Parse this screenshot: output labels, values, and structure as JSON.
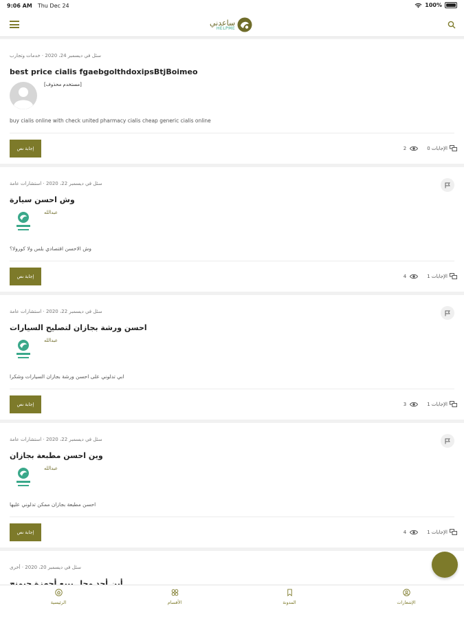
{
  "status_bar": {
    "time": "9:06 AM",
    "day": "Thu Dec 24",
    "battery": "100%"
  },
  "header": {
    "logo_ar": "ساعدني",
    "logo_en": "HELPME"
  },
  "posts": [
    {
      "meta": "سئل في ديسمبر 24، 2020 · خدمات وتجارب",
      "title": "best price cialis fgaebgolthdoxipsBtjBoimeo",
      "author": "[مستخدم محذوف]",
      "avatar": "default",
      "excerpt": "buy cialis online with check united pharmacy cialis cheap generic cialis online",
      "answer_label": "إجابة نص",
      "views": "2",
      "answers": "الإجابات 0",
      "flag": false
    },
    {
      "meta": "سئل في ديسمبر 22، 2020 · استشارات عامة",
      "title": "وش احسن سيارة",
      "author": "عبدالله",
      "avatar": "logo",
      "excerpt": "وش الاحسن اقتصادي بلس ولا كورولا؟",
      "answer_label": "إجابة نص",
      "views": "4",
      "answers": "الإجابات 1",
      "flag": true
    },
    {
      "meta": "سئل في ديسمبر 22، 2020 · استشارات عامة",
      "title": "احسن ورشة بجازان لتصليح السيارات",
      "author": "عبدالله",
      "avatar": "logo",
      "excerpt": "ابي تدلوني على احسن ورشة بجازان السيارات وشكرا",
      "answer_label": "إجابة نص",
      "views": "3",
      "answers": "الإجابات 1",
      "flag": true
    },
    {
      "meta": "سئل في ديسمبر 22، 2020 · استشارات عامة",
      "title": "وين احسن مطبعة بجازان",
      "author": "عبدالله",
      "avatar": "logo",
      "excerpt": "احسن مطبعة بجازان ممكن تدلوني عليها",
      "answer_label": "إجابة نص",
      "views": "4",
      "answers": "الإجابات 1",
      "flag": true
    },
    {
      "meta": "سئل في ديسمبر 20، 2020 · أخرى",
      "title": "أين أجد محل يبيع أجهزة جيمنج",
      "author": "",
      "avatar": "none",
      "excerpt": "",
      "answer_label": "",
      "views": "",
      "answers": "",
      "flag": true
    }
  ],
  "bottom_nav": {
    "home": "الرئيسية",
    "categories": "الأقسام",
    "articles": "المدونة",
    "notifications": "الإشعارات"
  },
  "colors": {
    "brand": "#7d7a2a",
    "logo_green": "#3aa88a",
    "background": "#f1f1f1"
  }
}
